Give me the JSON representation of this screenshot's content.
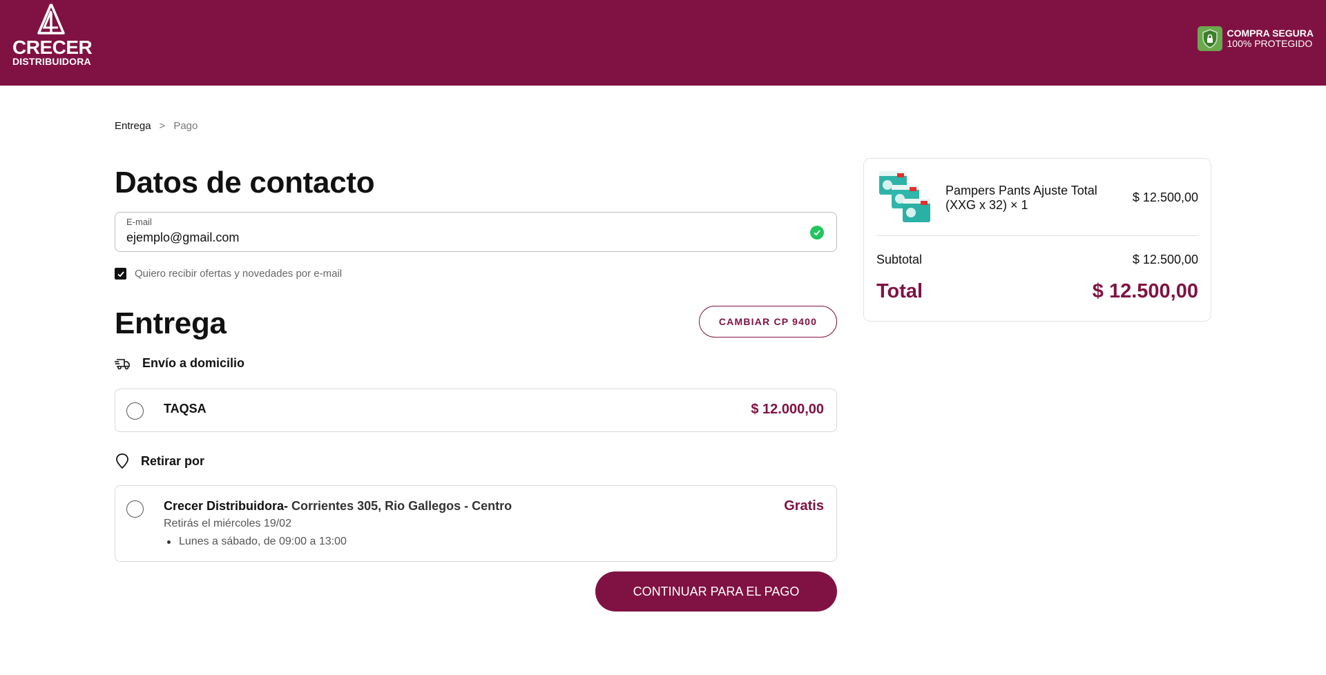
{
  "brand": {
    "logo_name": "CRECER",
    "logo_sub": "DISTRIBUIDORA",
    "primary_color": "#801243"
  },
  "secure_badge": {
    "line1": "COMPRA SEGURA",
    "line2": "100% PROTEGIDO",
    "icon": "shield-lock-icon",
    "color": "#6aa84f"
  },
  "breadcrumb": {
    "current": "Entrega",
    "separator": ">",
    "next": "Pago"
  },
  "contact": {
    "title": "Datos de contacto",
    "email_label": "E-mail",
    "email_value": "ejemplo@gmail.com",
    "optin_checked": true,
    "optin_label": "Quiero recibir ofertas y novedades por e-mail"
  },
  "delivery": {
    "title": "Entrega",
    "change_cp_button": "CAMBIAR CP 9400",
    "home_label": "Envío a domicilio",
    "home_icon": "truck-icon",
    "home_options": [
      {
        "name": "TAQSA",
        "price": "$ 12.000,00",
        "selected": false
      }
    ],
    "pickup_label": "Retirar por",
    "pickup_icon": "location-pin-icon",
    "pickup_options": [
      {
        "name": "Crecer Distribuidora-",
        "address": " Corrientes 305, Rio Gallegos - Centro",
        "price": "Gratis",
        "date": "Retirás el miércoles 19/02",
        "hours": "Lunes a sábado, de 09:00 a 13:00",
        "selected": false
      }
    ]
  },
  "continue_button": "CONTINUAR PARA EL PAGO",
  "summary": {
    "product_name": "Pampers Pants Ajuste Total (XXG x 32) × 1",
    "product_price": "$ 12.500,00",
    "subtotal_label": "Subtotal",
    "subtotal_value": "$ 12.500,00",
    "total_label": "Total",
    "total_value": "$ 12.500,00"
  }
}
